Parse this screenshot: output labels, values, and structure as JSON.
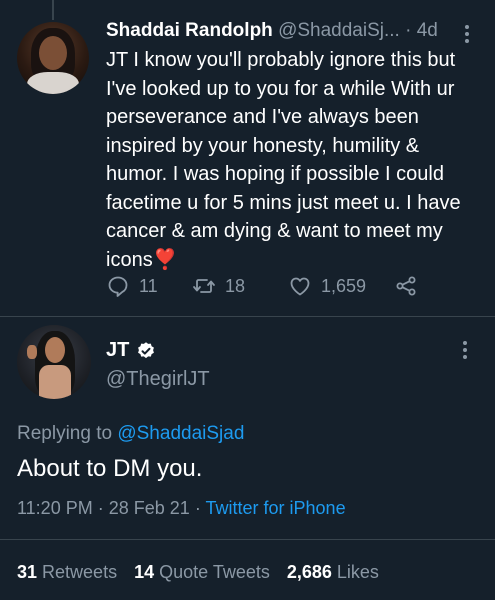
{
  "parent_tweet": {
    "name": "Shaddai Randolph",
    "handle": "@ShaddaiSj...",
    "dot": "·",
    "time": "4d",
    "text": "JT I know you'll probably ignore this but I've looked up to you for a while With ur perseverance and I've always been inspired by your honesty, humility & humor. I was hoping if possible I could facetime u for 5 mins just meet u. I have cancer & am dying & want to meet my icons",
    "emoji": "❣️",
    "replies": "11",
    "retweets": "18",
    "likes": "1,659"
  },
  "main_tweet": {
    "name": "JT",
    "handle": "@ThegirlJT",
    "replying_prefix": "Replying to",
    "replying_to": "@ShaddaiSjad",
    "text": "About to DM you.",
    "time": "11:20 PM",
    "sep1": "·",
    "date": "28 Feb 21",
    "sep2": "·",
    "source": "Twitter for iPhone"
  },
  "stats": {
    "retweets_count": "31",
    "retweets_label": "Retweets",
    "quotes_count": "14",
    "quotes_label": "Quote Tweets",
    "likes_count": "2,686",
    "likes_label": "Likes"
  },
  "colors": {
    "background": "#15202b",
    "link": "#1d9bf0",
    "secondary_text": "#8b98a5",
    "emoji_heart": "#e0245e"
  },
  "icons": {
    "reply": "reply-icon",
    "retweet": "retweet-icon",
    "like": "heart-icon",
    "share": "share-icon",
    "more": "more-vertical-icon",
    "verified": "verified-badge-icon"
  }
}
